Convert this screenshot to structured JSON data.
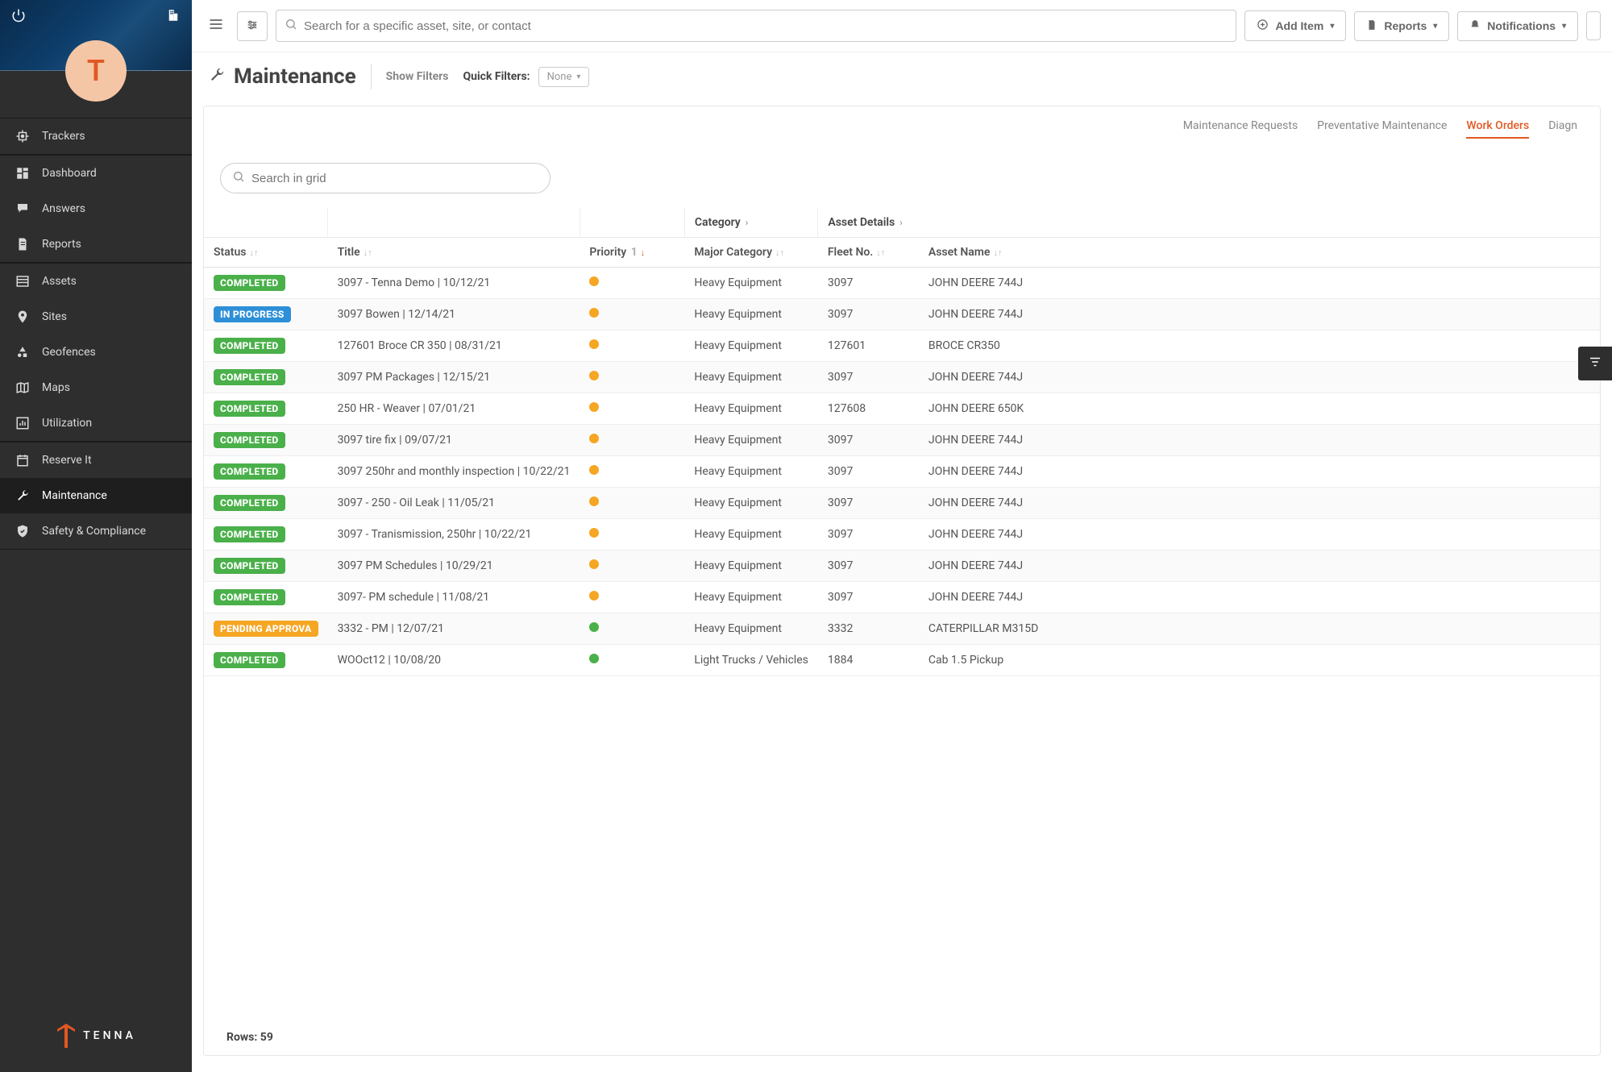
{
  "avatar_letter": "T",
  "brand": "TENNA",
  "sidebar": {
    "items": [
      {
        "label": "Trackers",
        "icon": "chip"
      },
      {
        "label": "Dashboard",
        "icon": "dashboard"
      },
      {
        "label": "Answers",
        "icon": "chat"
      },
      {
        "label": "Reports",
        "icon": "doc"
      },
      {
        "label": "Assets",
        "icon": "list"
      },
      {
        "label": "Sites",
        "icon": "pin"
      },
      {
        "label": "Geofences",
        "icon": "shapes"
      },
      {
        "label": "Maps",
        "icon": "map"
      },
      {
        "label": "Utilization",
        "icon": "bar"
      },
      {
        "label": "Reserve It",
        "icon": "calendar"
      },
      {
        "label": "Maintenance",
        "icon": "wrench"
      },
      {
        "label": "Safety & Compliance",
        "icon": "shield"
      }
    ]
  },
  "topbar": {
    "search_placeholder": "Search for a specific asset, site, or contact",
    "add_item": "Add Item",
    "reports": "Reports",
    "notifications": "Notifications"
  },
  "page": {
    "title": "Maintenance",
    "show_filters": "Show Filters",
    "quick_filters_label": "Quick Filters:",
    "quick_filters_value": "None"
  },
  "tabs": {
    "maintenance_requests": "Maintenance Requests",
    "preventative": "Preventative Maintenance",
    "work_orders": "Work Orders",
    "diagn": "Diagn"
  },
  "grid_search_placeholder": "Search in grid",
  "table": {
    "super_headers": {
      "category": "Category",
      "asset_details": "Asset Details"
    },
    "headers": {
      "status": "Status",
      "title": "Title",
      "priority": "Priority",
      "priority_sort": "1",
      "major_category": "Major Category",
      "fleet_no": "Fleet No.",
      "asset_name": "Asset Name"
    },
    "rows": [
      {
        "status": "COMPLETED",
        "status_type": "completed",
        "title": "3097 - Tenna Demo | 10/12/21",
        "priority": "orange",
        "major_category": "Heavy Equipment",
        "fleet_no": "3097",
        "asset_name": "JOHN DEERE 744J"
      },
      {
        "status": "IN PROGRESS",
        "status_type": "inprogress",
        "title": "3097 Bowen | 12/14/21",
        "priority": "orange",
        "major_category": "Heavy Equipment",
        "fleet_no": "3097",
        "asset_name": "JOHN DEERE 744J"
      },
      {
        "status": "COMPLETED",
        "status_type": "completed",
        "title": "127601 Broce CR 350 | 08/31/21",
        "priority": "orange",
        "major_category": "Heavy Equipment",
        "fleet_no": "127601",
        "asset_name": "BROCE CR350"
      },
      {
        "status": "COMPLETED",
        "status_type": "completed",
        "title": "3097 PM Packages | 12/15/21",
        "priority": "orange",
        "major_category": "Heavy Equipment",
        "fleet_no": "3097",
        "asset_name": "JOHN DEERE 744J"
      },
      {
        "status": "COMPLETED",
        "status_type": "completed",
        "title": "250 HR - Weaver | 07/01/21",
        "priority": "orange",
        "major_category": "Heavy Equipment",
        "fleet_no": "127608",
        "asset_name": "JOHN DEERE 650K"
      },
      {
        "status": "COMPLETED",
        "status_type": "completed",
        "title": "3097 tire fix | 09/07/21",
        "priority": "orange",
        "major_category": "Heavy Equipment",
        "fleet_no": "3097",
        "asset_name": "JOHN DEERE 744J"
      },
      {
        "status": "COMPLETED",
        "status_type": "completed",
        "title": "3097 250hr and monthly inspection | 10/22/21",
        "priority": "orange",
        "major_category": "Heavy Equipment",
        "fleet_no": "3097",
        "asset_name": "JOHN DEERE 744J"
      },
      {
        "status": "COMPLETED",
        "status_type": "completed",
        "title": "3097 - 250 - Oil Leak | 11/05/21",
        "priority": "orange",
        "major_category": "Heavy Equipment",
        "fleet_no": "3097",
        "asset_name": "JOHN DEERE 744J"
      },
      {
        "status": "COMPLETED",
        "status_type": "completed",
        "title": "3097 - Tranismission, 250hr | 10/22/21",
        "priority": "orange",
        "major_category": "Heavy Equipment",
        "fleet_no": "3097",
        "asset_name": "JOHN DEERE 744J"
      },
      {
        "status": "COMPLETED",
        "status_type": "completed",
        "title": "3097 PM Schedules | 10/29/21",
        "priority": "orange",
        "major_category": "Heavy Equipment",
        "fleet_no": "3097",
        "asset_name": "JOHN DEERE 744J"
      },
      {
        "status": "COMPLETED",
        "status_type": "completed",
        "title": "3097- PM schedule | 11/08/21",
        "priority": "orange",
        "major_category": "Heavy Equipment",
        "fleet_no": "3097",
        "asset_name": "JOHN DEERE 744J"
      },
      {
        "status": "PENDING APPROVA",
        "status_type": "pending",
        "title": "3332 - PM | 12/07/21",
        "priority": "green",
        "major_category": "Heavy Equipment",
        "fleet_no": "3332",
        "asset_name": "CATERPILLAR M315D"
      },
      {
        "status": "COMPLETED",
        "status_type": "completed",
        "title": "WOOct12 | 10/08/20",
        "priority": "green",
        "major_category": "Light Trucks / Vehicles",
        "fleet_no": "1884",
        "asset_name": "Cab 1.5 Pickup"
      }
    ],
    "rows_label": "Rows: ",
    "rows_count": "59"
  }
}
